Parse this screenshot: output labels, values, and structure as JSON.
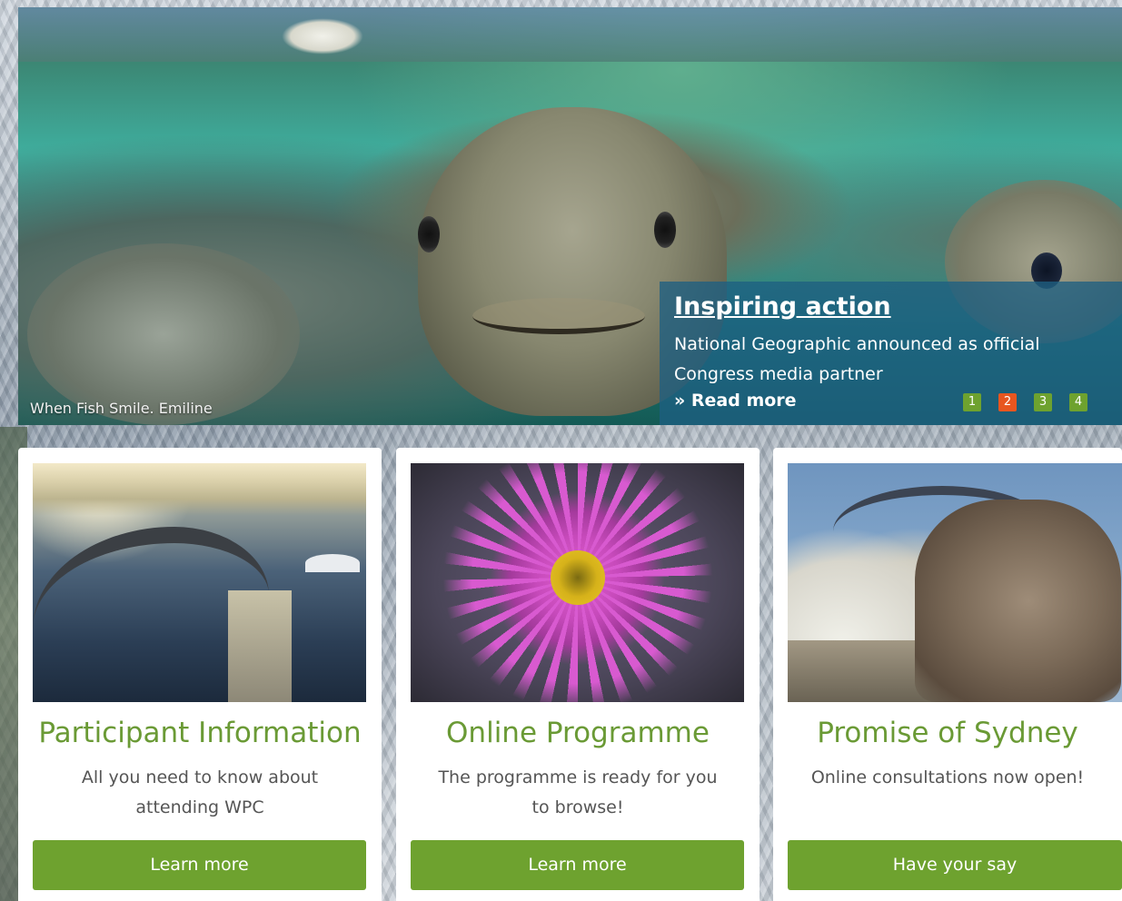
{
  "hero": {
    "caption": "When Fish Smile. Emiline",
    "title": "Inspiring action",
    "description": "National Geographic announced as official Congress media partner",
    "read_more": "» Read more",
    "slides": [
      "1",
      "2",
      "3",
      "4"
    ],
    "active_slide": "2"
  },
  "cards": [
    {
      "title": "Participant Information",
      "description": "All you need to know about attending WPC",
      "button": "Learn more"
    },
    {
      "title": "Online Programme",
      "description": "The programme is ready for you to browse!",
      "button": "Learn more"
    },
    {
      "title": "Promise of Sydney",
      "description": "Online consultations now open!",
      "button": "Have your say"
    }
  ],
  "colors": {
    "accent_green": "#6ea22f",
    "title_green": "#6a9a35",
    "active_dot": "#e8561f",
    "panel_blue": "#1e5f82"
  }
}
